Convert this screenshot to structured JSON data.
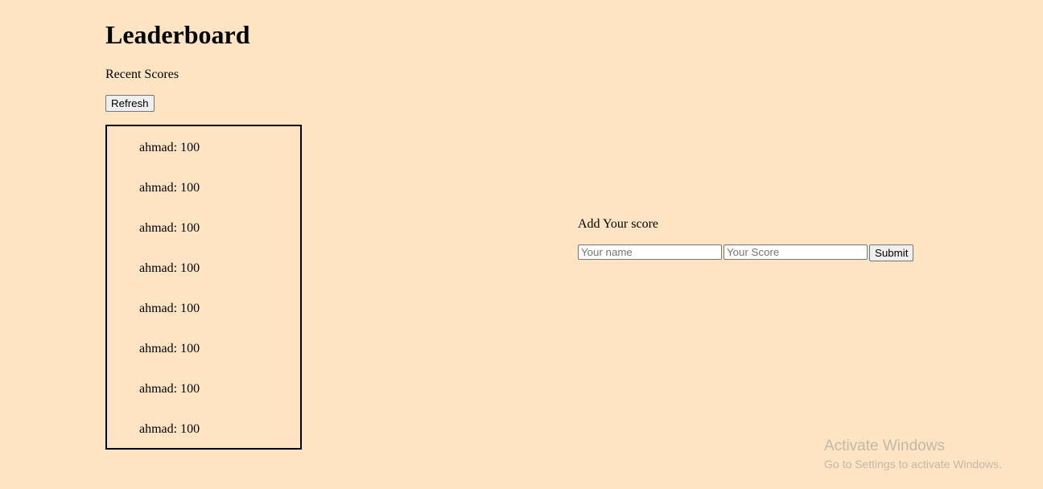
{
  "header": {
    "title": "Leaderboard",
    "subtitle": "Recent Scores",
    "refresh_label": "Refresh"
  },
  "scores": [
    {
      "text": "ahmad: 100"
    },
    {
      "text": "ahmad: 100"
    },
    {
      "text": "ahmad: 100"
    },
    {
      "text": "ahmad: 100"
    },
    {
      "text": "ahmad: 100"
    },
    {
      "text": "ahmad: 100"
    },
    {
      "text": "ahmad: 100"
    },
    {
      "text": "ahmad: 100"
    }
  ],
  "form": {
    "title": "Add Your score",
    "name_placeholder": "Your name",
    "score_placeholder": "Your Score",
    "submit_label": "Submit"
  },
  "watermark": {
    "line1": "Activate Windows",
    "line2": "Go to Settings to activate Windows."
  },
  "colors": {
    "background": "#ffe4c4"
  }
}
